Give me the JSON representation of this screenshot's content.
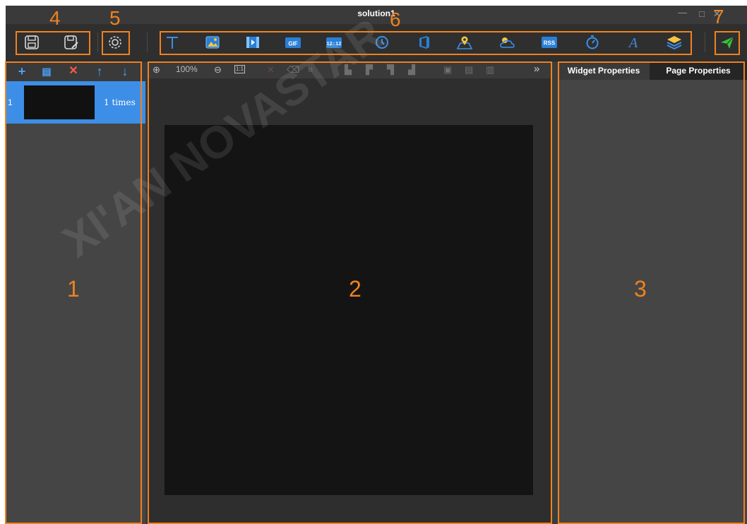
{
  "window": {
    "title": "solution1",
    "minimize_label": "—",
    "maximize_label": "□",
    "close_label": "✕"
  },
  "watermark": "XI'AN NOVASTAR",
  "toolbar": {
    "file_buttons": [
      {
        "name": "save-icon"
      },
      {
        "name": "save-as-icon"
      }
    ],
    "settings": {
      "name": "gear-icon"
    },
    "widgets": [
      {
        "name": "text-icon",
        "label": "T"
      },
      {
        "name": "image-icon"
      },
      {
        "name": "video-icon"
      },
      {
        "name": "gif-icon",
        "label": "GIF"
      },
      {
        "name": "digital-clock-icon",
        "label": "12:12"
      },
      {
        "name": "analog-clock-icon"
      },
      {
        "name": "office-icon"
      },
      {
        "name": "map-location-icon"
      },
      {
        "name": "weather-icon"
      },
      {
        "name": "rss-icon",
        "label": "RSS"
      },
      {
        "name": "timer-icon"
      },
      {
        "name": "art-text-icon",
        "label": "A"
      },
      {
        "name": "layers-icon"
      }
    ],
    "publish": {
      "name": "send-icon"
    }
  },
  "left_panel": {
    "tools": [
      {
        "name": "add-page-icon",
        "glyph": "+",
        "color": "#4aa3ff"
      },
      {
        "name": "copy-page-icon",
        "glyph": "▤",
        "color": "#4aa3ff"
      },
      {
        "name": "delete-page-icon",
        "glyph": "✕",
        "color": "#ff5a4a"
      },
      {
        "name": "move-up-icon",
        "glyph": "↑",
        "color": "#4aa3ff"
      },
      {
        "name": "move-down-icon",
        "glyph": "↓",
        "color": "#4aa3ff"
      }
    ],
    "pages": [
      {
        "index": "1",
        "times": "1  times"
      }
    ]
  },
  "canvas_toolbar": {
    "zoom_in": "⊕",
    "zoom_level": "100%",
    "zoom_out": "⊖",
    "actual_size": "1:1",
    "delete": "✕",
    "more": "»"
  },
  "right_panel": {
    "tabs": [
      {
        "label": "Widget Properties",
        "active": true
      },
      {
        "label": "Page Properties",
        "active": false
      }
    ]
  },
  "annotations": {
    "callouts": [
      "4",
      "5",
      "6",
      "7"
    ],
    "region_labels": [
      "1",
      "2",
      "3"
    ]
  },
  "colors": {
    "accent_blue": "#3d8ee6",
    "annotation_orange": "#f0821e",
    "publish_green": "#3ac23a"
  }
}
